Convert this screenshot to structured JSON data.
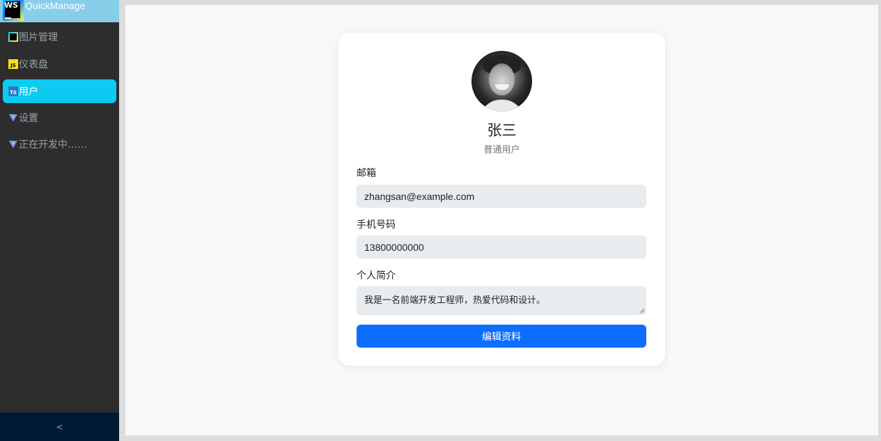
{
  "app": {
    "name": "QuickManage"
  },
  "sidebar": {
    "items": [
      {
        "label": "图片管理",
        "icon": "webstorm-icon",
        "active": false
      },
      {
        "label": "仪表盘",
        "icon": "javascript-icon",
        "active": false
      },
      {
        "label": "用户",
        "icon": "typescript-icon",
        "active": true
      },
      {
        "label": "设置",
        "icon": "vite-icon",
        "active": false
      },
      {
        "label": "正在开发中……",
        "icon": "vite-icon",
        "active": false
      }
    ],
    "collapse_label": "<",
    "icon_text": {
      "js": "JS",
      "ts": "TS",
      "ws": "WS"
    }
  },
  "profile": {
    "name": "张三",
    "role": "普通用户",
    "email_label": "邮箱",
    "email_value": "zhangsan@example.com",
    "phone_label": "手机号码",
    "phone_value": "13800000000",
    "bio_label": "个人简介",
    "bio_value": "我是一名前端开发工程师，热爱代码和设计。",
    "edit_button": "编辑资料"
  },
  "colors": {
    "sidebar_bg": "#2d2d2d",
    "logo_bar_bg": "#87ceeb",
    "active_item": "#0dcaf0",
    "primary_button": "#0d6efd",
    "collapse_bar_bg": "#001a33"
  }
}
